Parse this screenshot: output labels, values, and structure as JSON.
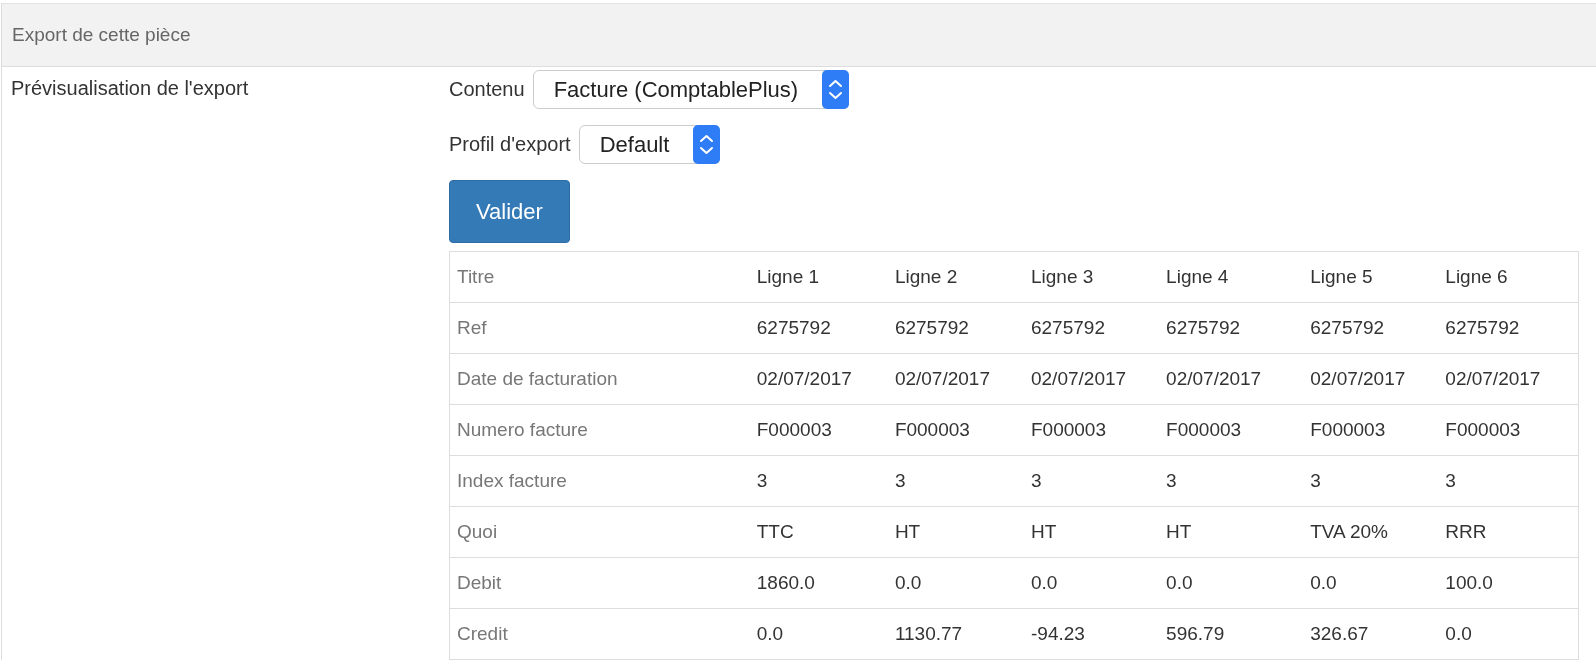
{
  "panel": {
    "title": "Export de cette pièce"
  },
  "section_label": "Prévisualisation de l'export",
  "fields": [
    {
      "label": "Contenu",
      "value": "Facture (ComptablePlus)"
    },
    {
      "label": "Profil d'export",
      "value": "Default"
    }
  ],
  "submit_button": "Valider",
  "table": {
    "rows": [
      {
        "label": "Titre",
        "cells": [
          "Ligne 1",
          "Ligne 2",
          "Ligne 3",
          "Ligne 4",
          "Ligne 5",
          "Ligne 6"
        ]
      },
      {
        "label": "Ref",
        "cells": [
          "6275792",
          "6275792",
          "6275792",
          "6275792",
          "6275792",
          "6275792"
        ]
      },
      {
        "label": "Date de facturation",
        "cells": [
          "02/07/2017",
          "02/07/2017",
          "02/07/2017",
          "02/07/2017",
          "02/07/2017",
          "02/07/2017"
        ]
      },
      {
        "label": "Numero facture",
        "cells": [
          "F000003",
          "F000003",
          "F000003",
          "F000003",
          "F000003",
          "F000003"
        ]
      },
      {
        "label": "Index facture",
        "cells": [
          "3",
          "3",
          "3",
          "3",
          "3",
          "3"
        ]
      },
      {
        "label": "Quoi",
        "cells": [
          "TTC",
          "HT",
          "HT",
          "HT",
          "TVA 20%",
          "RRR"
        ]
      },
      {
        "label": "Debit",
        "cells": [
          "1860.0",
          "0.0",
          "0.0",
          "0.0",
          "0.0",
          "100.0"
        ]
      },
      {
        "label": "Credit",
        "cells": [
          "0.0",
          "1130.77",
          "-94.23",
          "596.79",
          "326.67",
          "0.0"
        ]
      }
    ]
  }
}
